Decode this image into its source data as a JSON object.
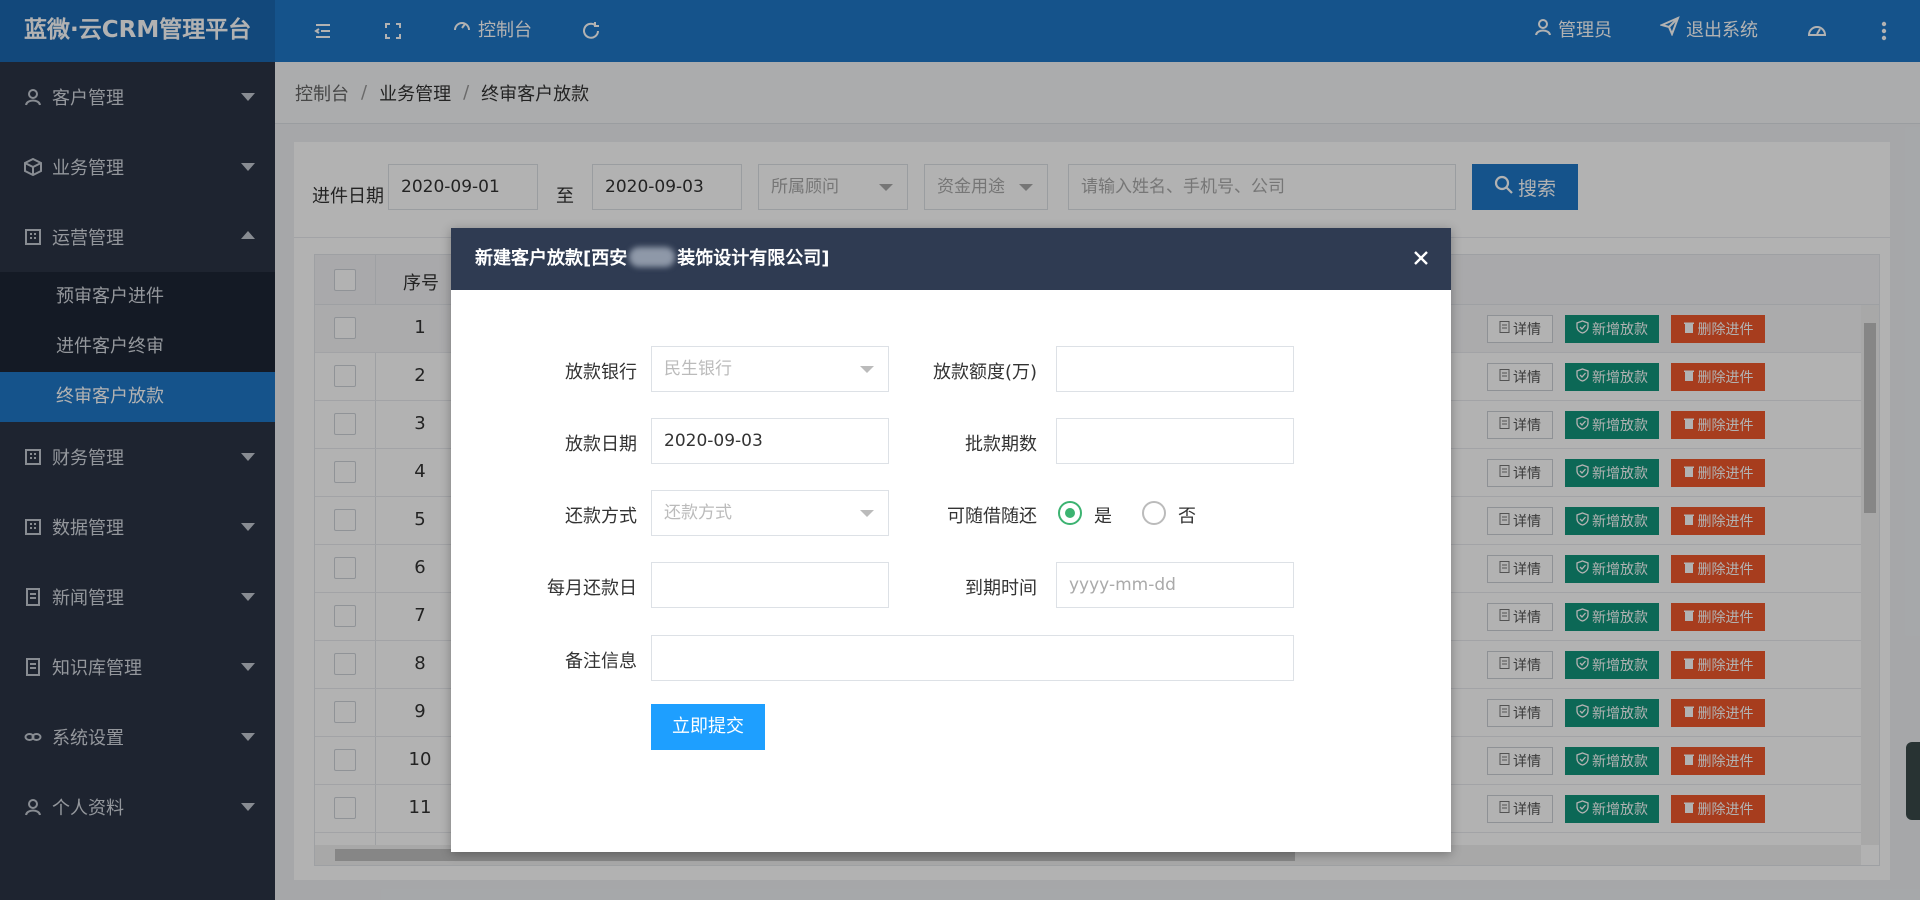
{
  "header": {
    "logo": "蓝微·云CRM管理平台",
    "dashboard": "控制台",
    "user": "管理员",
    "logout": "退出系统"
  },
  "sidebar": {
    "items": [
      {
        "label": "客户管理",
        "icon": "user-icon"
      },
      {
        "label": "业务管理",
        "icon": "cube-icon"
      },
      {
        "label": "运营管理",
        "icon": "building-icon"
      },
      {
        "label": "财务管理",
        "icon": "building-icon"
      },
      {
        "label": "数据管理",
        "icon": "building-icon"
      },
      {
        "label": "新闻管理",
        "icon": "document-icon"
      },
      {
        "label": "知识库管理",
        "icon": "document-icon"
      },
      {
        "label": "系统设置",
        "icon": "link-icon"
      },
      {
        "label": "个人资料",
        "icon": "user-icon"
      }
    ],
    "sub_items": [
      {
        "label": "预审客户进件"
      },
      {
        "label": "进件客户终审"
      },
      {
        "label": "终审客户放款"
      }
    ]
  },
  "breadcrumb": {
    "items": [
      "控制台",
      "业务管理",
      "终审客户放款"
    ],
    "sep": "/"
  },
  "filter": {
    "date_label": "进件日期",
    "date_from": "2020-09-01",
    "to_label": "至",
    "date_to": "2020-09-03",
    "advisor_placeholder": "所属顾问",
    "purpose_placeholder": "资金用途",
    "keyword_placeholder": "请输入姓名、手机号、公司",
    "search_label": "搜索"
  },
  "table": {
    "seq_header": "序号",
    "rows": [
      "1",
      "2",
      "3",
      "4",
      "5",
      "6",
      "7",
      "8",
      "9",
      "10",
      "11"
    ],
    "detail_label": "详情",
    "add_label": "新增放款",
    "delete_label": "删除进件"
  },
  "modal": {
    "title_prefix": "新建客户放款[西安",
    "title_suffix": "装饰设计有限公司]",
    "bank_label": "放款银行",
    "bank_value": "民生银行",
    "amount_label": "放款额度(万)",
    "amount_value": "",
    "date_label": "放款日期",
    "date_value": "2020-09-03",
    "period_label": "批款期数",
    "period_value": "",
    "repay_method_label": "还款方式",
    "repay_method_placeholder": "还款方式",
    "anytime_label": "可随借随还",
    "anytime_yes": "是",
    "anytime_no": "否",
    "monthly_day_label": "每月还款日",
    "monthly_day_value": "",
    "due_label": "到期时间",
    "due_placeholder": "yyyy-mm-dd",
    "remark_label": "备注信息",
    "remark_value": "",
    "submit_label": "立即提交"
  },
  "colors": {
    "header_blue": "#1f78c8",
    "sidebar_bg": "#2b3445",
    "modal_head": "#2f3b52",
    "btn_green": "#12957c",
    "btn_orange": "#f0582c",
    "submit_blue": "#1e9fff"
  }
}
